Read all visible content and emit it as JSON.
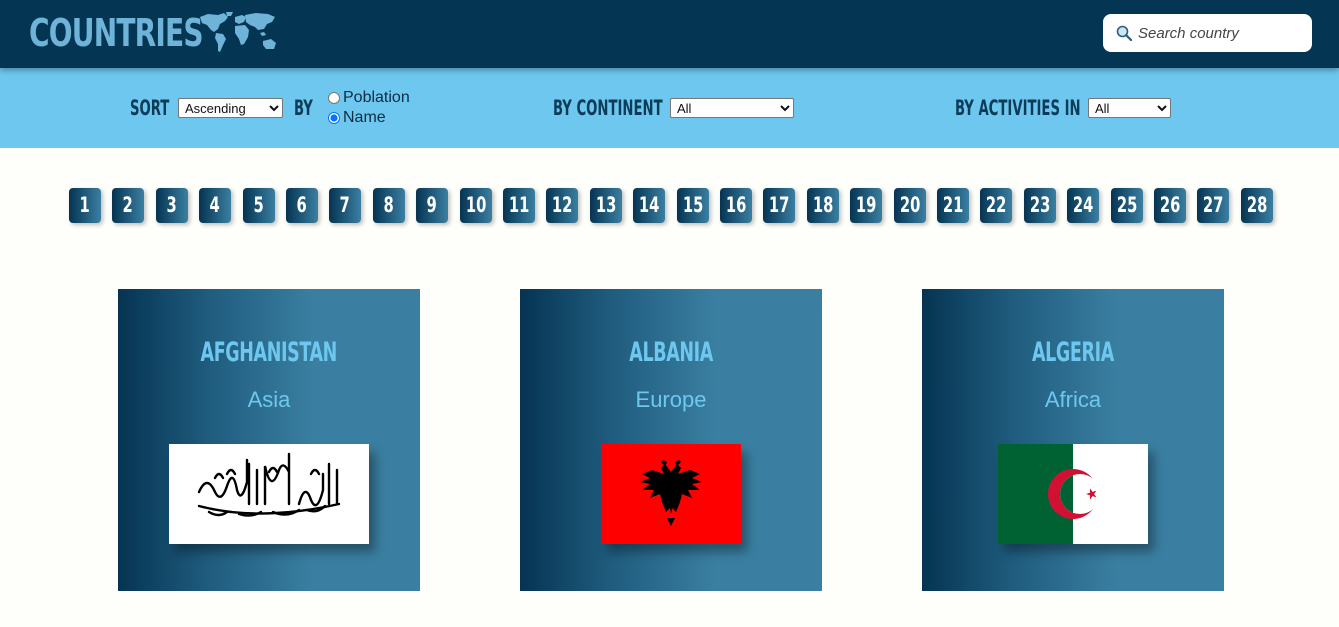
{
  "header": {
    "logo_text": "COUNTRIES",
    "logo_icon": "world-map-icon",
    "search": {
      "placeholder": "Search country",
      "value": "",
      "icon": "search-icon"
    }
  },
  "filters": {
    "sort_label": "SORT",
    "sort_selected": "Ascending",
    "by_label": "BY",
    "radio_options": [
      "Poblation",
      "Name"
    ],
    "radio_selected": "Name",
    "continent_label": "BY CONTINENT",
    "continent_selected": "All",
    "activities_label": "BY ACTIVITIES IN",
    "activities_selected": "All"
  },
  "pagination": {
    "pages": [
      "1",
      "2",
      "3",
      "4",
      "5",
      "6",
      "7",
      "8",
      "9",
      "10",
      "11",
      "12",
      "13",
      "14",
      "15",
      "16",
      "17",
      "18",
      "19",
      "20",
      "21",
      "22",
      "23",
      "24",
      "25",
      "26",
      "27",
      "28"
    ]
  },
  "cards": [
    {
      "name": "AFGHANISTAN",
      "continent": "Asia",
      "flag": "afghanistan-flag"
    },
    {
      "name": "ALBANIA",
      "continent": "Europe",
      "flag": "albania-flag"
    },
    {
      "name": "ALGERIA",
      "continent": "Africa",
      "flag": "algeria-flag"
    }
  ],
  "colors": {
    "header_bg": "#043654",
    "filter_bar_bg": "#6ec7ef",
    "accent_light": "#6ec7ef",
    "card_gradient_start": "#063452",
    "card_gradient_end": "#3a7fa1"
  }
}
